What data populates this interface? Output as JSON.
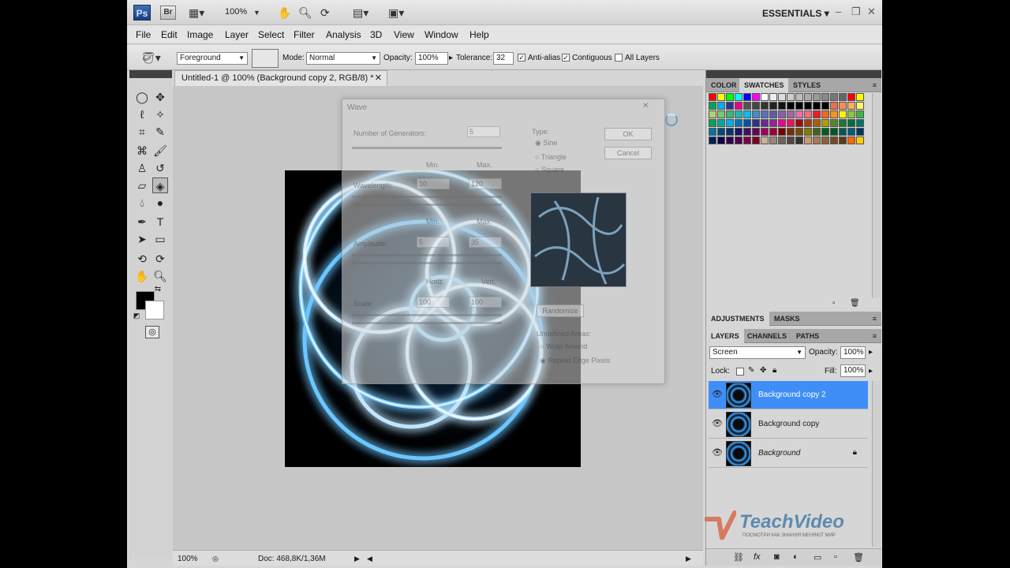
{
  "appbar": {
    "ps_logo": "Ps",
    "br_logo": "Br",
    "zoom": "100%",
    "workspace": "ESSENTIALS"
  },
  "menu": [
    "File",
    "Edit",
    "Image",
    "Layer",
    "Select",
    "Filter",
    "Analysis",
    "3D",
    "View",
    "Window",
    "Help"
  ],
  "options": {
    "fill_source": "Foreground",
    "mode_label": "Mode:",
    "mode_value": "Normal",
    "opacity_label": "Opacity:",
    "opacity_value": "100%",
    "tolerance_label": "Tolerance:",
    "tolerance_value": "32",
    "antialias_label": "Anti-alias",
    "contiguous_label": "Contiguous",
    "alllayers_label": "All Layers"
  },
  "document": {
    "tab_title": "Untitled-1 @ 100% (Background copy 2, RGB/8) *"
  },
  "dialog": {
    "title": "Wave",
    "generators_label": "Number of Generators:",
    "generators_value": "5",
    "min_label": "Min.",
    "max_label": "Max.",
    "wavelength_label": "Wavelength:",
    "wavelength_min": "10",
    "wavelength_max": "120",
    "amplitude_label": "Amplitude:",
    "amplitude_min": "5",
    "amplitude_max": "35",
    "horiz_label": "Horiz.",
    "vert_label": "Vert.",
    "scale_label": "Scale:",
    "scale_horiz": "100",
    "scale_vert": "100",
    "type_label": "Type:",
    "type_sine": "Sine",
    "type_triangle": "Triangle",
    "type_square": "Square",
    "ok": "OK",
    "cancel": "Cancel",
    "randomize": "Randomize",
    "undefined_label": "Undefined Areas:",
    "wrap_around": "Wrap Around",
    "repeat_edge": "Repeat Edge Pixels"
  },
  "status": {
    "zoom": "100%",
    "doc": "Doc: 468,8K/1,36M"
  },
  "panels": {
    "top_tabs": [
      "COLOR",
      "SWATCHES",
      "STYLES"
    ],
    "mid_tabs": [
      "ADJUSTMENTS",
      "MASKS"
    ],
    "layer_tabs": [
      "LAYERS",
      "CHANNELS",
      "PATHS"
    ],
    "blend_mode": "Screen",
    "opacity_label": "Opacity:",
    "opacity_value": "100%",
    "lock_label": "Lock:",
    "fill_label": "Fill:",
    "fill_value": "100%"
  },
  "layers": [
    {
      "name": "Background copy 2",
      "selected": true,
      "locked": false
    },
    {
      "name": "Background copy",
      "selected": false,
      "locked": false
    },
    {
      "name": "Background",
      "selected": false,
      "locked": true
    }
  ],
  "watermark": {
    "brand": "TeachVideo",
    "tagline": "ПОСМОТРИ КАК ЗНАНИЯ МЕНЯЮТ МИР"
  },
  "colors": {
    "selection": "#3f8ef7",
    "panel_bg": "#d6d6d6",
    "canvas_bg": "#c6c6c6"
  }
}
